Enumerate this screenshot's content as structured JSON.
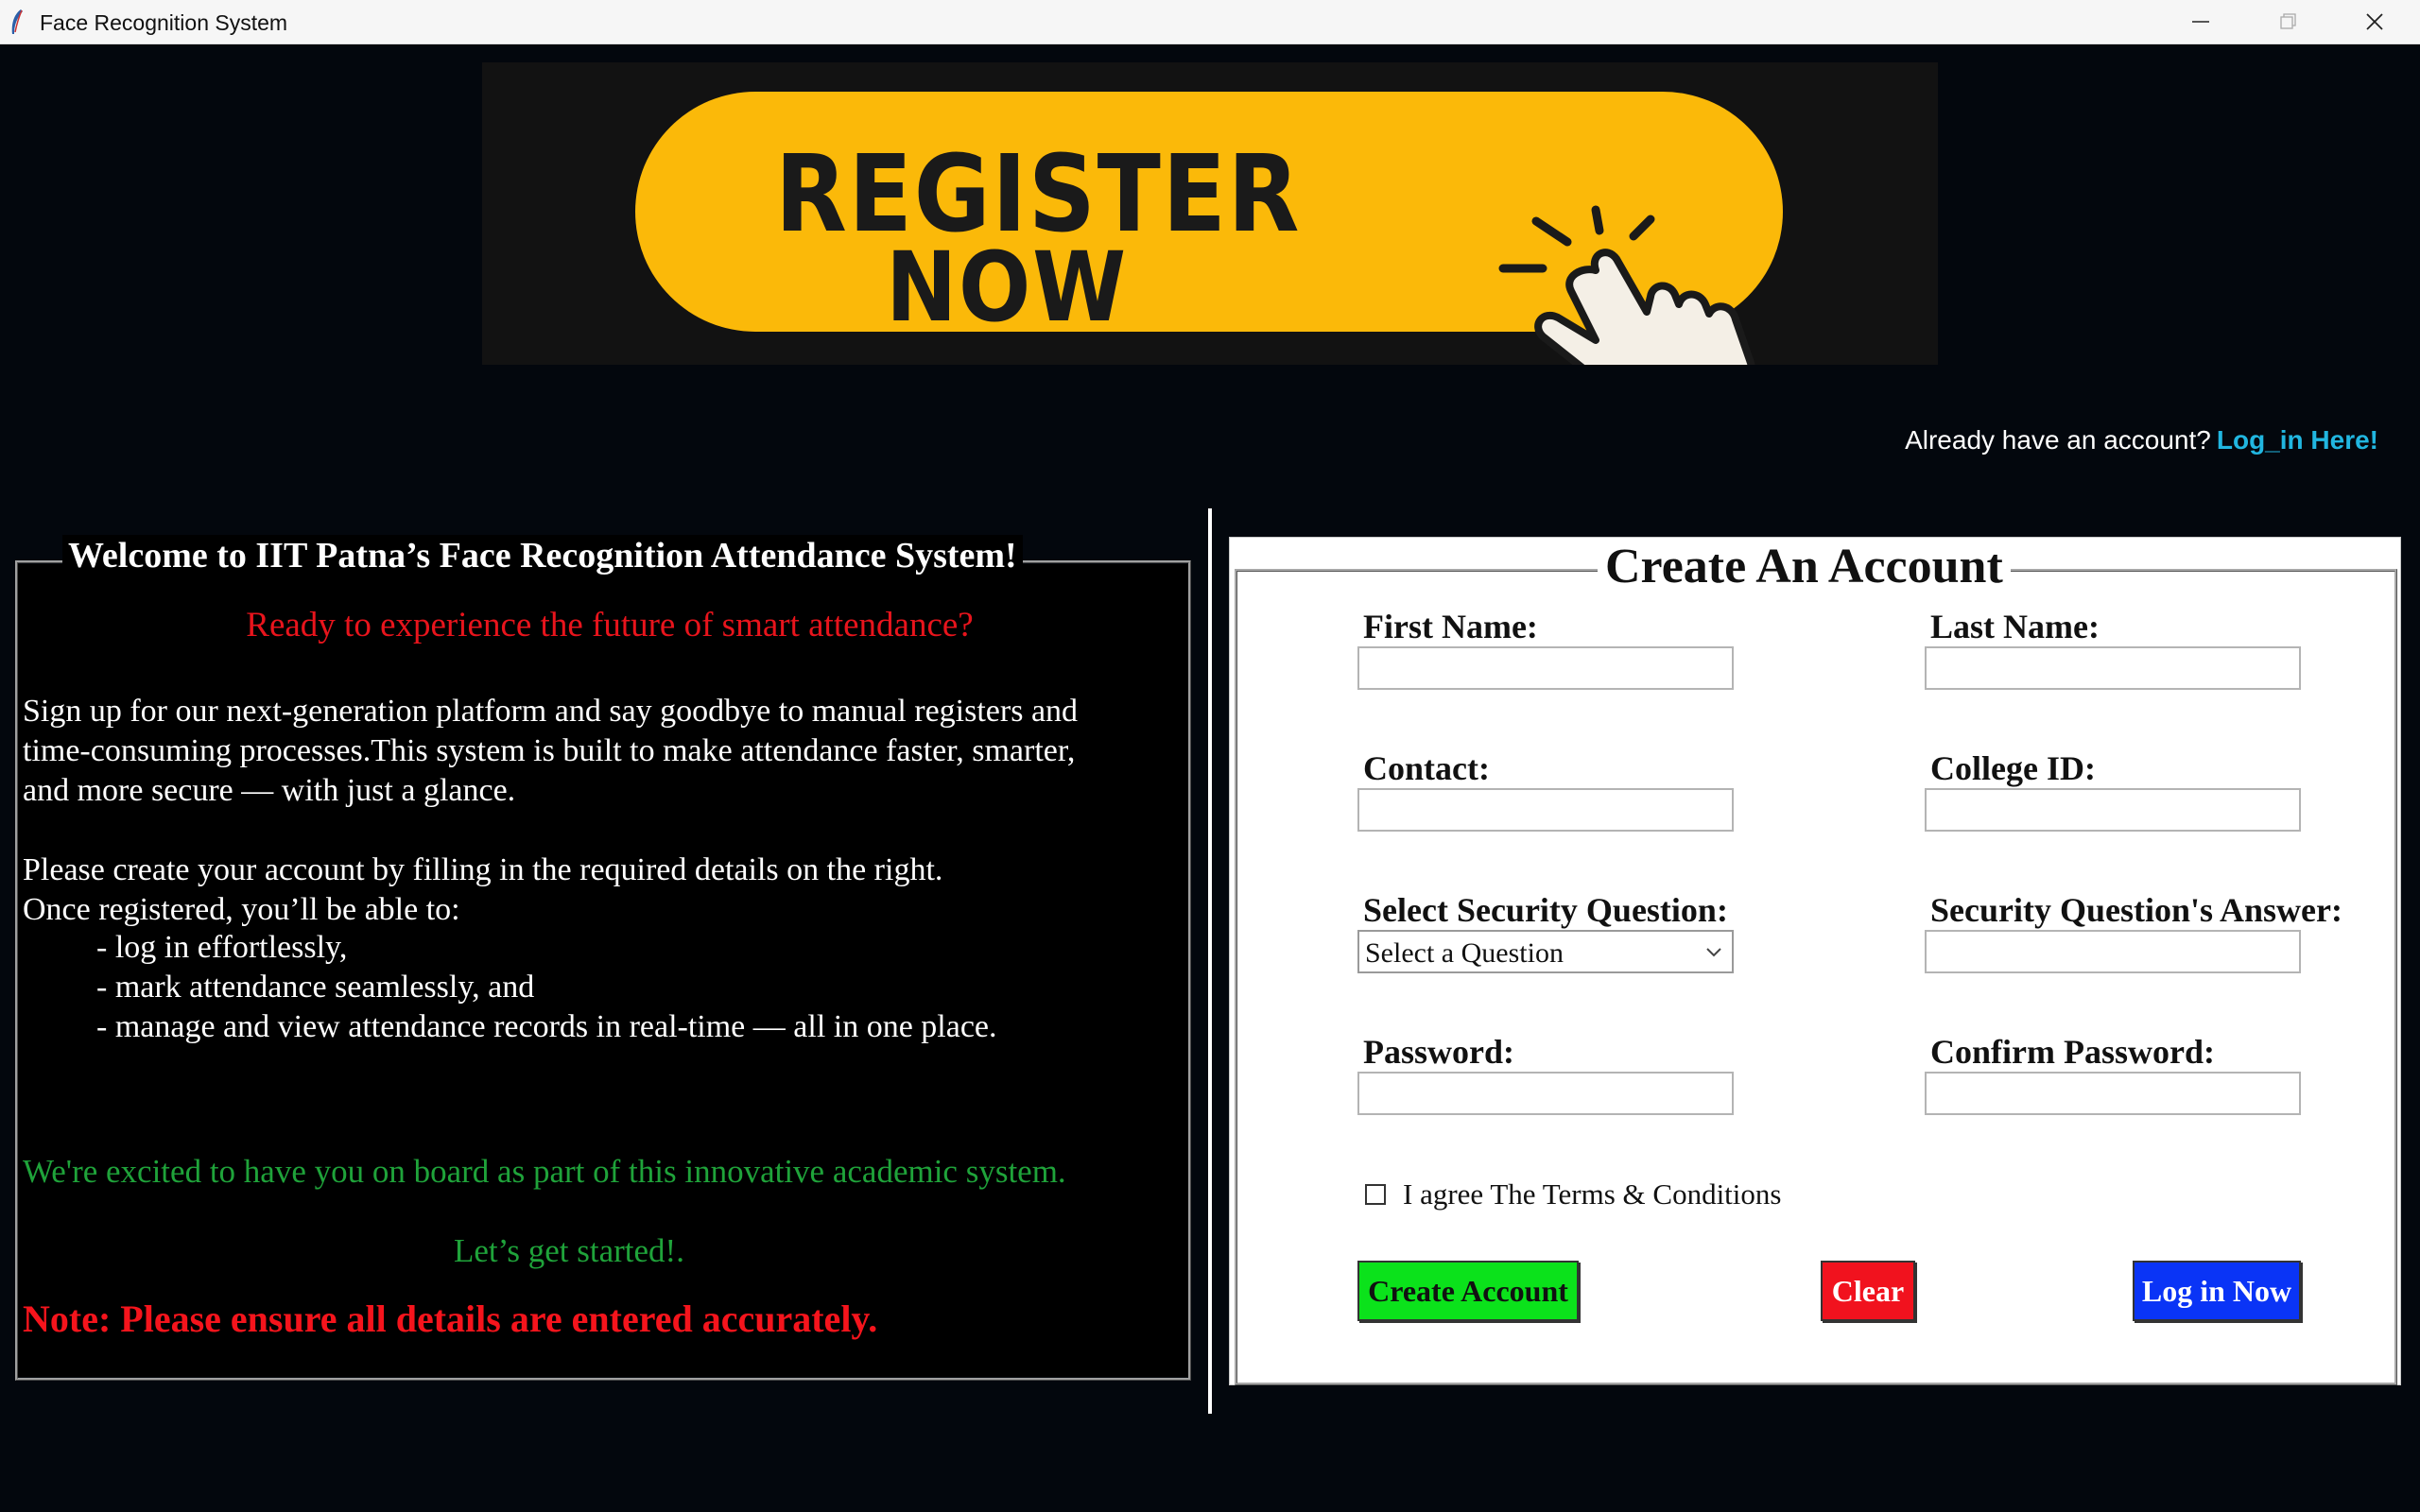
{
  "window": {
    "title": "Face Recognition System",
    "controls": [
      "minimize-icon",
      "maximize-icon",
      "close-icon"
    ]
  },
  "banner": {
    "line1": "REGISTER",
    "line2": "NOW",
    "icon": "pointing-hand-icon",
    "colors": {
      "pill": "#fbb909",
      "text": "#1a1a1a",
      "background": "#121212"
    }
  },
  "account_prompt": {
    "text": "Already have an account?",
    "link": "Log_in Here!"
  },
  "welcome": {
    "title": "Welcome to IIT Patna’s Face Recognition Attendance System!",
    "tagline": "Ready to experience the future of smart attendance?",
    "intro_lines": [
      "Sign up for our next-generation platform and say goodbye to manual registers and",
      "time-consuming processes.This system is built to make attendance faster, smarter,",
      "and more secure — with just a glance."
    ],
    "instructions_lines": [
      "Please create your account by filling in the required details on the right.",
      "Once registered, you’ll be able to:"
    ],
    "bullets": [
      "- log in effortlessly,",
      "- mark attendance seamlessly, and",
      "- manage and view attendance records in real-time — all in one place."
    ],
    "excited": "We're excited to have you on board as part of this innovative academic system.",
    "started": "Let’s get started!.",
    "note": "Note: Please ensure all details are entered accurately."
  },
  "form": {
    "title": "Create An Account",
    "first_name": {
      "label": "First Name:",
      "value": ""
    },
    "last_name": {
      "label": "Last Name:",
      "value": ""
    },
    "contact": {
      "label": "Contact:",
      "value": ""
    },
    "college_id": {
      "label": "College ID:",
      "value": ""
    },
    "security_question": {
      "label": "Select Security Question:",
      "selected": "Select a Question"
    },
    "security_answer": {
      "label": "Security Question's Answer:",
      "value": ""
    },
    "password": {
      "label": "Password:",
      "value": ""
    },
    "confirm_password": {
      "label": "Confirm Password:",
      "value": ""
    },
    "agree": {
      "label": "I agree The Terms & Conditions",
      "checked": false
    },
    "buttons": {
      "create": "Create Account",
      "clear": "Clear",
      "login": "Log in Now"
    },
    "colors": {
      "create": "#0be21b",
      "clear": "#f1121e",
      "login": "#0a34f6"
    }
  }
}
